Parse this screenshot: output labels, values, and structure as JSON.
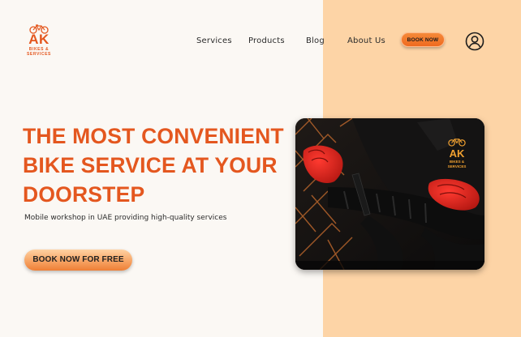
{
  "brand": {
    "logo_text": "AK",
    "logo_sub1": "BIKES &",
    "logo_sub2": "SERVICES",
    "accent_color": "#e4571f",
    "panel_color": "#fdd4a6"
  },
  "nav": {
    "services": "Services",
    "products": "Products",
    "blog": "Blog",
    "about": "About Us",
    "book_now": "BOOK NOW",
    "user_icon": "user-circle-icon"
  },
  "hero": {
    "title_lines": [
      "THE MOST CONVENIENT",
      "BIKE SERVICE AT YOUR",
      "DOORSTEP"
    ],
    "subtitle": "Mobile workshop in UAE providing high-quality services",
    "cta": "BOOK NOW FOR FREE",
    "image": {
      "description_icon": "mechanic-handlebar-photo",
      "shirt_logo_text": "AK",
      "shirt_logo_sub1": "BIKES &",
      "shirt_logo_sub2": "SERVICES"
    }
  }
}
